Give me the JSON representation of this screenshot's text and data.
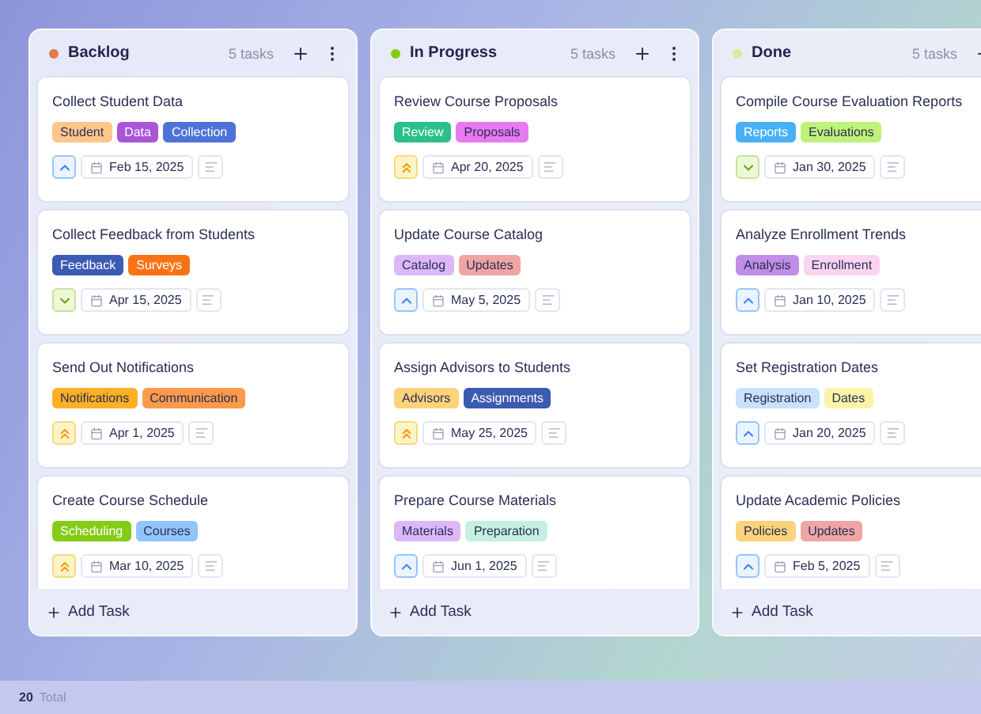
{
  "columns": [
    {
      "title": "Backlog",
      "color": "#e07a4a",
      "count": "5 tasks",
      "add_task": "Add Task",
      "cards": [
        {
          "title": "Collect Student Data",
          "kind": "medium",
          "date": "Feb 15, 2025",
          "tags": [
            {
              "label": "Student",
              "color": "#fdc68a"
            },
            {
              "label": "Data",
              "color": "#a855d8"
            },
            {
              "label": "Collection",
              "color": "#4f72d6"
            }
          ]
        },
        {
          "title": "Collect Feedback from Students",
          "kind": "low",
          "date": "Apr 15, 2025",
          "tags": [
            {
              "label": "Feedback",
              "color": "#3b5bb5"
            },
            {
              "label": "Surveys",
              "color": "#f97316"
            }
          ]
        },
        {
          "title": "Send Out Notifications",
          "kind": "high",
          "date": "Apr 1, 2025",
          "tags": [
            {
              "label": "Notifications",
              "color": "#fbb024"
            },
            {
              "label": "Communication",
              "color": "#fb9a4b"
            }
          ]
        },
        {
          "title": "Create Course Schedule",
          "kind": "high",
          "date": "Mar 10, 2025",
          "tags": [
            {
              "label": "Scheduling",
              "color": "#84cc16"
            },
            {
              "label": "Courses",
              "color": "#93c5fd"
            }
          ]
        }
      ]
    },
    {
      "title": "In Progress",
      "color": "#84cc16",
      "count": "5 tasks",
      "add_task": "Add Task",
      "cards": [
        {
          "title": "Review Course Proposals",
          "kind": "high",
          "date": "Apr 20, 2025",
          "tags": [
            {
              "label": "Review",
              "color": "#2bbf8a"
            },
            {
              "label": "Proposals",
              "color": "#e879f0"
            }
          ]
        },
        {
          "title": "Update Course Catalog",
          "kind": "medium",
          "date": "May 5, 2025",
          "tags": [
            {
              "label": "Catalog",
              "color": "#dcb8fb"
            },
            {
              "label": "Updates",
              "color": "#f0a5a5"
            }
          ]
        },
        {
          "title": "Assign Advisors to Students",
          "kind": "high",
          "date": "May 25, 2025",
          "tags": [
            {
              "label": "Advisors",
              "color": "#fcd27a"
            },
            {
              "label": "Assignments",
              "color": "#3b5bb0"
            }
          ]
        },
        {
          "title": "Prepare Course Materials",
          "kind": "medium",
          "date": "Jun 1, 2025",
          "tags": [
            {
              "label": "Materials",
              "color": "#dcb8fb"
            },
            {
              "label": "Preparation",
              "color": "#c5f0e0"
            }
          ]
        }
      ]
    },
    {
      "title": "Done",
      "color": "#d6eaa0",
      "count": "5 tasks",
      "add_task": "Add Task",
      "cards": [
        {
          "title": "Compile Course Evaluation Reports",
          "kind": "low",
          "date": "Jan 30, 2025",
          "tags": [
            {
              "label": "Reports",
              "color": "#4ab0f5"
            },
            {
              "label": "Evaluations",
              "color": "#bef27a"
            }
          ]
        },
        {
          "title": "Analyze Enrollment Trends",
          "kind": "medium",
          "date": "Jan 10, 2025",
          "tags": [
            {
              "label": "Analysis",
              "color": "#c08ee6"
            },
            {
              "label": "Enrollment",
              "color": "#fbd5f0"
            }
          ]
        },
        {
          "title": "Set Registration Dates",
          "kind": "medium",
          "date": "Jan 20, 2025",
          "tags": [
            {
              "label": "Registration",
              "color": "#c7e2fa"
            },
            {
              "label": "Dates",
              "color": "#fdf3a8"
            }
          ]
        },
        {
          "title": "Update Academic Policies",
          "kind": "medium",
          "date": "Feb 5, 2025",
          "tags": [
            {
              "label": "Policies",
              "color": "#fcd27a"
            },
            {
              "label": "Updates",
              "color": "#f0a5a5"
            }
          ]
        }
      ]
    }
  ],
  "status_bar": {
    "total": "20",
    "label": "Total"
  }
}
